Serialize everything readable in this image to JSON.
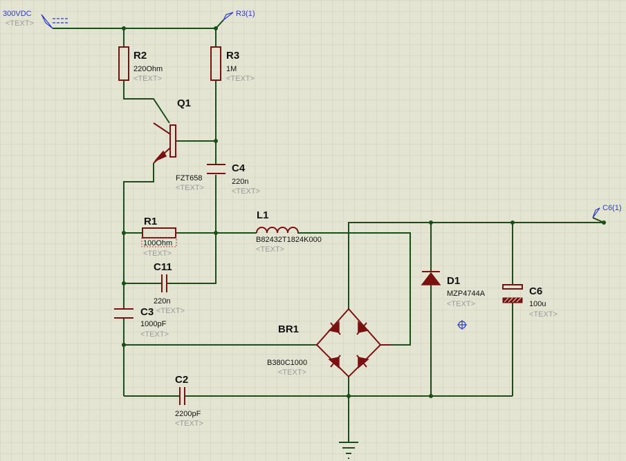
{
  "placeholder": "<TEXT>",
  "colors": {
    "background": "#e4e4d2",
    "grid": "#cfcfbd",
    "wire": "#1b4d1b",
    "component": "#7a1010",
    "terminal": "#2a3cc8",
    "placeholder": "#9a9a9a"
  },
  "terminals": {
    "input": "300VDC",
    "r3_probe": "R3(1)",
    "output": "C6(1)"
  },
  "components": {
    "R2": {
      "ref": "R2",
      "value": "220Ohm"
    },
    "R3": {
      "ref": "R3",
      "value": "1M"
    },
    "Q1": {
      "ref": "Q1",
      "value": "FZT658"
    },
    "C4": {
      "ref": "C4",
      "value": "220n"
    },
    "R1": {
      "ref": "R1",
      "value": "100Ohm"
    },
    "L1": {
      "ref": "L1",
      "value": "B82432T1824K000"
    },
    "C11": {
      "ref": "C11",
      "value": "220n"
    },
    "C3": {
      "ref": "C3",
      "value": "1000pF"
    },
    "BR1": {
      "ref": "BR1",
      "value": "B380C1000"
    },
    "C2": {
      "ref": "C2",
      "value": "2200pF"
    },
    "D1": {
      "ref": "D1",
      "value": "MZP4744A"
    },
    "C6": {
      "ref": "C6",
      "value": "100u"
    }
  },
  "icons": [
    "ground-symbol",
    "origin-marker-icon",
    "terminal-flag-icon"
  ]
}
